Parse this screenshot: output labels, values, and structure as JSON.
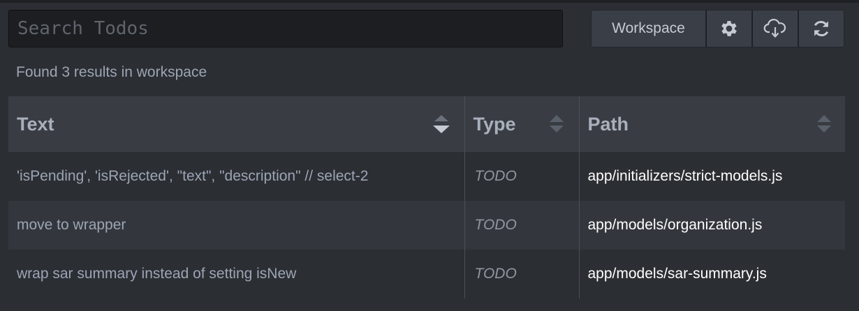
{
  "search": {
    "placeholder": "Search Todos",
    "value": ""
  },
  "toolbar": {
    "workspace_label": "Workspace",
    "settings_icon": "gear-icon",
    "export_icon": "cloud-download-icon",
    "refresh_icon": "refresh-icon"
  },
  "summary": "Found 3 results in workspace",
  "table": {
    "columns": [
      {
        "label": "Text",
        "sort_icon": "sort-icon",
        "sorted": "desc"
      },
      {
        "label": "Type",
        "sort_icon": "sort-icon",
        "sorted": "none"
      },
      {
        "label": "Path",
        "sort_icon": "sort-icon",
        "sorted": "none"
      }
    ],
    "rows": [
      {
        "text": "'isPending', 'isRejected', \"text\", \"description\" // select-2",
        "type": "TODO",
        "path": "app/initializers/strict-models.js"
      },
      {
        "text": "move to wrapper",
        "type": "TODO",
        "path": "app/models/organization.js"
      },
      {
        "text": "wrap sar summary instead of setting isNew",
        "type": "TODO",
        "path": "app/models/sar-summary.js"
      }
    ]
  },
  "colors": {
    "background": "#2b2e33",
    "header": "#393d43",
    "row_alt": "#33373d",
    "path_text": "#ffffff"
  }
}
